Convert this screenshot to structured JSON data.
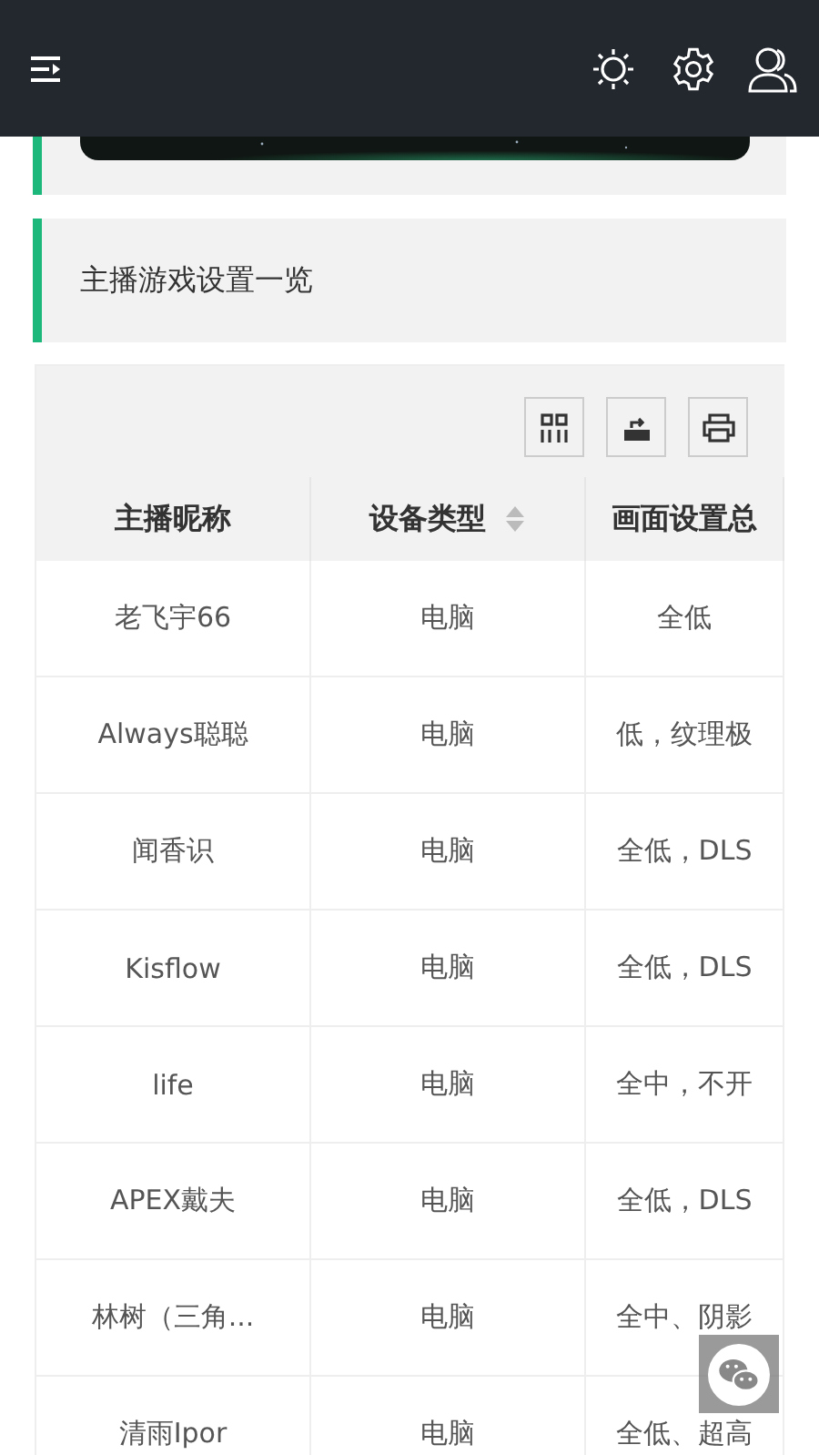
{
  "section_title": "主播游戏设置一览",
  "table": {
    "columns": [
      {
        "label": "主播昵称",
        "sortable": false
      },
      {
        "label": "设备类型",
        "sortable": true
      },
      {
        "label": "画面设置总",
        "sortable": false
      }
    ],
    "rows": [
      [
        "老飞宇66",
        "电脑",
        "全低"
      ],
      [
        "Always聪聪",
        "电脑",
        "低，纹理极"
      ],
      [
        "闻香识",
        "电脑",
        "全低，DLS"
      ],
      [
        "Kisflow",
        "电脑",
        "全低，DLS"
      ],
      [
        "life",
        "电脑",
        "全中，不开"
      ],
      [
        "APEX戴夫",
        "电脑",
        "全低，DLS"
      ],
      [
        "林树（三角...",
        "电脑",
        "全中、阴影"
      ],
      [
        "清雨Ipor",
        "电脑",
        "全低、超高"
      ]
    ]
  }
}
